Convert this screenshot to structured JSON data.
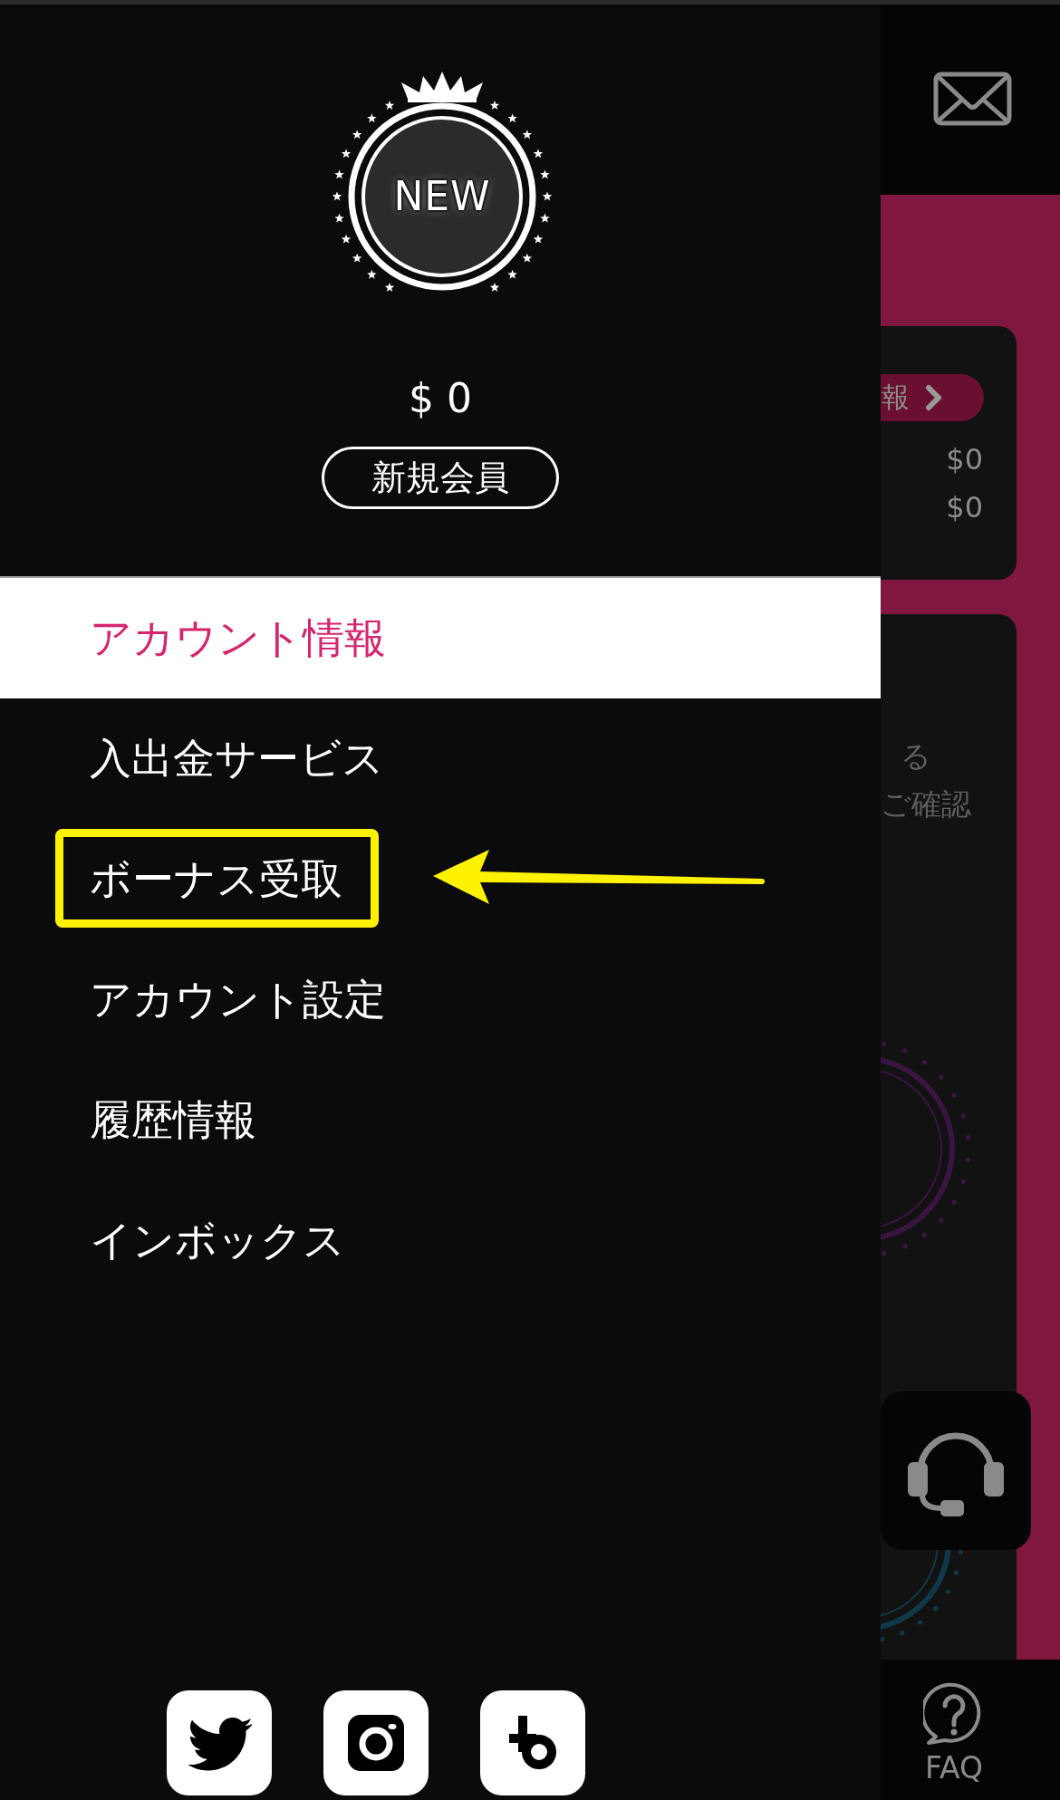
{
  "drawer": {
    "badge": {
      "label": "NEW"
    },
    "balance": "$ 0",
    "member_tag": "新規会員",
    "menu": [
      {
        "label": "アカウント情報",
        "selected": true,
        "highlighted": false
      },
      {
        "label": "入出金サービス",
        "selected": false,
        "highlighted": false
      },
      {
        "label": "ボーナス受取",
        "selected": false,
        "highlighted": true
      },
      {
        "label": "アカウント設定",
        "selected": false,
        "highlighted": false
      },
      {
        "label": "履歴情報",
        "selected": false,
        "highlighted": false
      },
      {
        "label": "インボックス",
        "selected": false,
        "highlighted": false
      }
    ],
    "social_links": [
      {
        "kind": "bird"
      },
      {
        "kind": "camera"
      },
      {
        "kind": "b"
      }
    ]
  },
  "background_page": {
    "summary_card": {
      "tab_label": "報",
      "amounts": [
        "$0",
        "$0"
      ]
    },
    "info_card": {
      "lines": [
        "る",
        "ご確認"
      ]
    },
    "bottom_nav": {
      "faq_label": "FAQ"
    }
  }
}
